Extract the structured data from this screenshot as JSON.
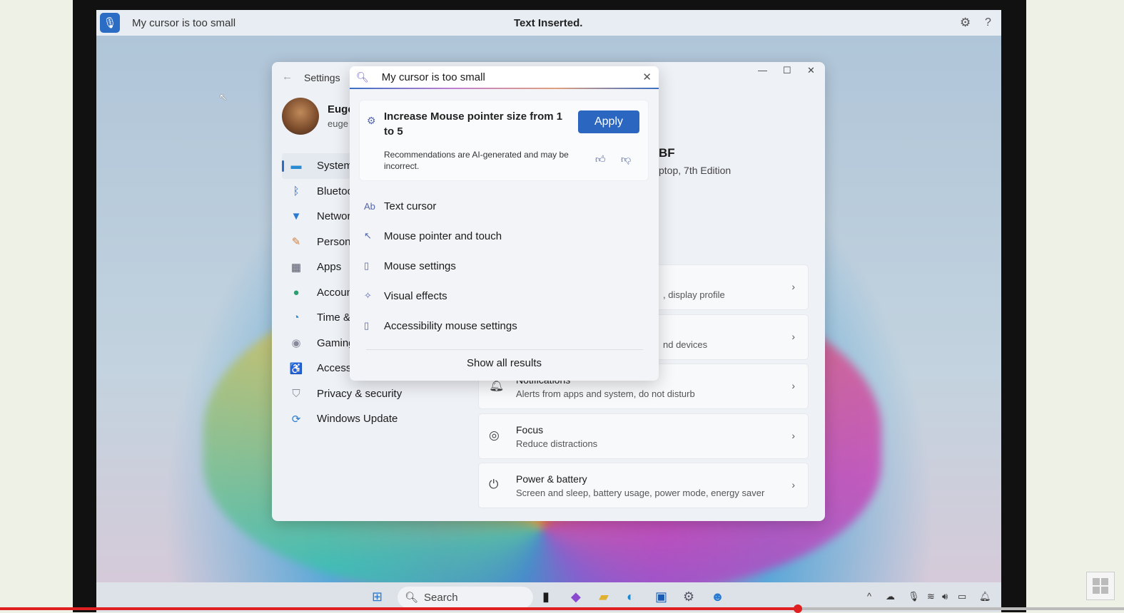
{
  "voice_bar": {
    "query": "My cursor is too small",
    "status": "Text Inserted."
  },
  "settings": {
    "title": "Settings",
    "user": {
      "name": "Euge",
      "email": "euge"
    },
    "nav": [
      {
        "label": "System",
        "icon": "monitor-icon"
      },
      {
        "label": "Bluetoot",
        "icon": "bluetooth-icon"
      },
      {
        "label": "Network",
        "icon": "wifi-icon"
      },
      {
        "label": "Personal",
        "icon": "brush-icon"
      },
      {
        "label": "Apps",
        "icon": "apps-icon"
      },
      {
        "label": "Account",
        "icon": "person-icon"
      },
      {
        "label": "Time &",
        "icon": "clock-icon"
      },
      {
        "label": "Gaming",
        "icon": "gamepad-icon"
      },
      {
        "label": "Accessib",
        "icon": "accessibility-icon"
      },
      {
        "label": "Privacy & security",
        "icon": "shield-icon"
      },
      {
        "label": "Windows Update",
        "icon": "update-icon"
      }
    ],
    "device": {
      "name": "BF",
      "model": "ptop, 7th Edition"
    },
    "cards": [
      {
        "title": "",
        "subtitle": ", display profile"
      },
      {
        "title": "",
        "subtitle": "nd devices"
      },
      {
        "title": "Notifications",
        "subtitle": "Alerts from apps and system, do not disturb"
      },
      {
        "title": "Focus",
        "subtitle": "Reduce distractions"
      },
      {
        "title": "Power & battery",
        "subtitle": "Screen and sleep, battery usage, power mode, energy saver"
      }
    ]
  },
  "search": {
    "value": "My cursor is too small",
    "recommendation": {
      "text": "Increase Mouse pointer size from 1 to 5",
      "apply": "Apply",
      "disclaimer": "Recommendations are AI-generated and may be incorrect."
    },
    "results": [
      "Text cursor",
      "Mouse pointer and touch",
      "Mouse settings",
      "Visual effects",
      "Accessibility mouse settings"
    ],
    "show_all": "Show all results"
  },
  "taskbar": {
    "search": "Search"
  },
  "video_progress": 0.71
}
